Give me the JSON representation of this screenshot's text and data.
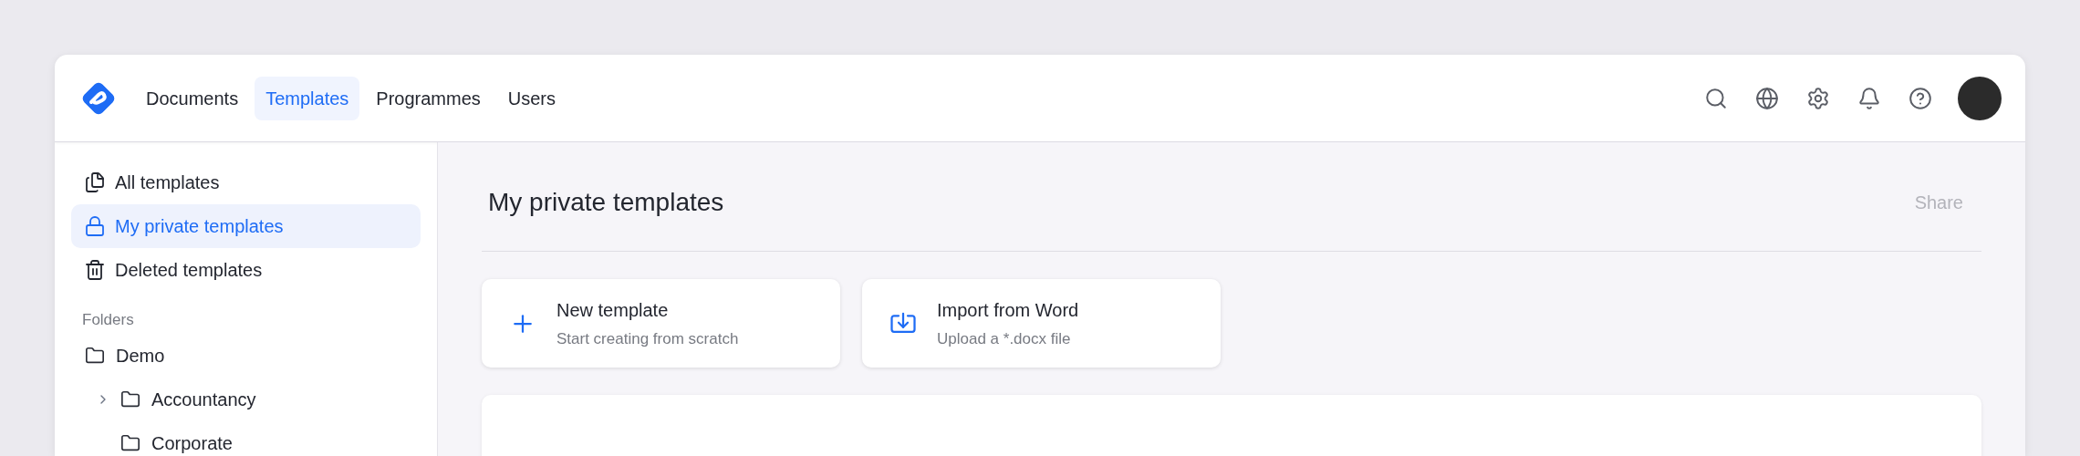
{
  "nav": {
    "items": [
      {
        "label": "Documents",
        "selected": false
      },
      {
        "label": "Templates",
        "selected": true
      },
      {
        "label": "Programmes",
        "selected": false
      },
      {
        "label": "Users",
        "selected": false
      }
    ]
  },
  "sidebar": {
    "items": [
      {
        "label": "All templates",
        "selected": false
      },
      {
        "label": "My private templates",
        "selected": true
      },
      {
        "label": "Deleted templates",
        "selected": false
      }
    ],
    "folders_heading": "Folders",
    "folders": [
      {
        "label": "Demo",
        "children": [
          {
            "label": "Accountancy",
            "kind": "collapsible",
            "expanded": false
          },
          {
            "label": "Corporate",
            "kind": "leaf"
          }
        ]
      }
    ]
  },
  "main": {
    "title": "My private templates",
    "share": {
      "label": "Share",
      "disabled": true
    },
    "actions": [
      {
        "title": "New template",
        "subtitle": "Start creating from scratch"
      },
      {
        "title": "Import from Word",
        "subtitle": "Upload a *.docx file"
      }
    ]
  }
}
